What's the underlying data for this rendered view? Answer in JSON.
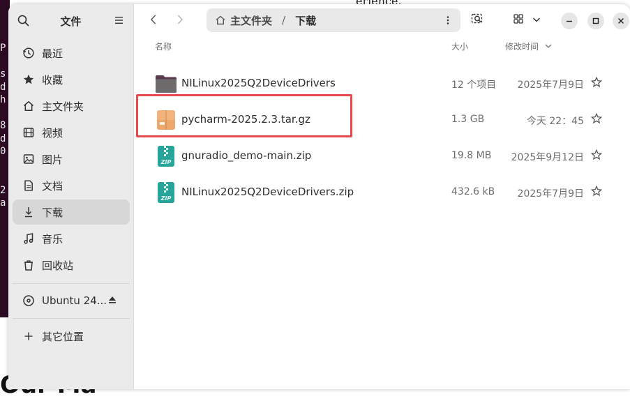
{
  "window": {
    "title": "文件"
  },
  "sidebar": {
    "items": [
      {
        "label": "最近",
        "icon": "clock-icon"
      },
      {
        "label": "收藏",
        "icon": "star-icon"
      },
      {
        "label": "主文件夹",
        "icon": "home-icon"
      },
      {
        "label": "视频",
        "icon": "film-icon"
      },
      {
        "label": "图片",
        "icon": "image-icon"
      },
      {
        "label": "文档",
        "icon": "document-icon"
      },
      {
        "label": "下载",
        "icon": "download-icon",
        "active": true
      },
      {
        "label": "音乐",
        "icon": "music-icon"
      },
      {
        "label": "回收站",
        "icon": "trash-icon"
      }
    ],
    "devices": [
      {
        "label": "Ubuntu 24...",
        "icon": "disc-icon",
        "eject_icon": "eject-icon"
      }
    ],
    "other_locations": {
      "label": "其它位置",
      "icon": "plus-icon"
    }
  },
  "toolbar": {
    "back_icon": "chevron-left-icon",
    "forward_icon": "chevron-right-icon",
    "path": {
      "home_label": "主文件夹",
      "separator": "/",
      "current": "下载"
    },
    "search_icon": "search-icon",
    "view_icon": "grid-view-icon",
    "view_menu_icon": "chevron-down-icon",
    "minimize_icon": "minimize-icon",
    "maximize_icon": "maximize-icon",
    "close_icon": "close-icon"
  },
  "columns": {
    "name": "名称",
    "size": "大小",
    "modified": "修改时间"
  },
  "files": [
    {
      "name": "NILinux2025Q2DeviceDrivers",
      "size": "12 个项目",
      "modified": "2025年7月9日",
      "type": "folder",
      "starred": false
    },
    {
      "name": "pycharm-2025.2.3.tar.gz",
      "size": "1.3 GB",
      "modified": "今天 22：45",
      "type": "archive",
      "starred": false,
      "highlighted": true
    },
    {
      "name": "gnuradio_demo-main.zip",
      "size": "19.8 MB",
      "modified": "2025年9月12日",
      "type": "zip",
      "starred": false
    },
    {
      "name": "NILinux2025Q2DeviceDrivers.zip",
      "size": "432.6 kB",
      "modified": "2025年7月9日",
      "type": "zip",
      "starred": false
    }
  ],
  "background": {
    "top_peek_text": "erience.",
    "left_chars": [
      "P",
      "",
      "s",
      "d",
      "h",
      "",
      "8",
      "d",
      "0",
      "",
      "",
      "2",
      "a"
    ],
    "bottom_peek_text": "Our Ma"
  },
  "colors": {
    "highlight": "#e8494c",
    "zip_icon": "#26a69a",
    "archive_icon": "#e8a468",
    "folder_icon": "#6d5060"
  }
}
